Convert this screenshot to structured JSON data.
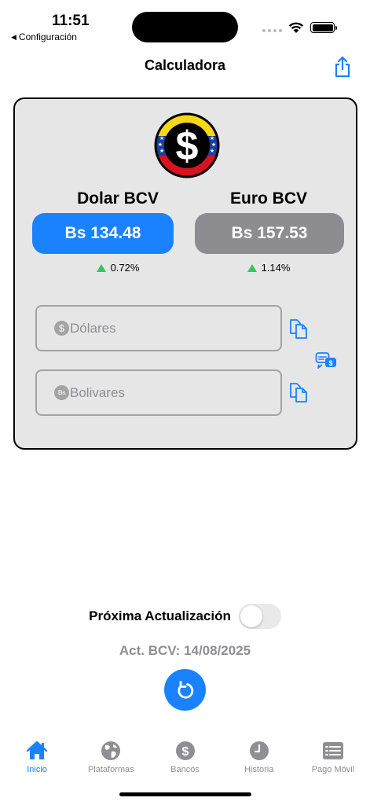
{
  "status_bar": {
    "time": "11:51",
    "back_label": "Configuración"
  },
  "nav": {
    "title": "Calculadora",
    "share_icon": "share-icon"
  },
  "rates": {
    "dollar": {
      "label": "Dolar BCV",
      "value": "Bs 134.48",
      "change": "0.72%"
    },
    "euro": {
      "label": "Euro BCV",
      "value": "Bs 157.53",
      "change": "1.14%"
    }
  },
  "inputs": {
    "usd": {
      "coin": "$",
      "placeholder": "Dólares",
      "value": ""
    },
    "ves": {
      "coin": "Bs",
      "placeholder": "Bolivares",
      "value": ""
    }
  },
  "next_update": {
    "label": "Próxima Actualización",
    "enabled": false
  },
  "last_update": "Act. BCV: 14/08/2025",
  "tabs": [
    {
      "label": "Inicio",
      "icon": "house-icon",
      "active": true
    },
    {
      "label": "Plataformas",
      "icon": "globe-icon",
      "active": false
    },
    {
      "label": "Bancos",
      "icon": "dollar-circle-icon",
      "active": false
    },
    {
      "label": "Historia",
      "icon": "clock-icon",
      "active": false
    },
    {
      "label": "Pago Móvil",
      "icon": "list-icon",
      "active": false
    }
  ],
  "colors": {
    "accent": "#1a82ff",
    "gray_button": "#8c8c91",
    "up": "#34c759",
    "card_bg": "#e6e6e6",
    "inactive": "#8e8e93"
  }
}
